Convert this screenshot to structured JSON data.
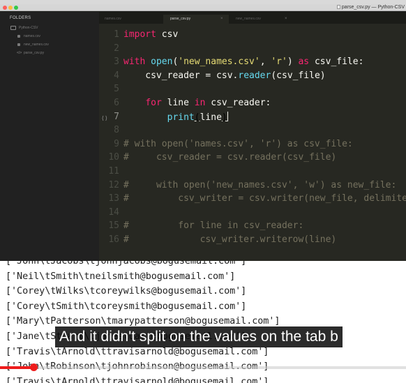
{
  "window": {
    "title": "parse_csv.py — Python-CSV"
  },
  "sidebar": {
    "heading": "FOLDERS",
    "items": [
      {
        "label": "Python-CSV",
        "type": "folder"
      },
      {
        "label": "names.csv",
        "type": "file"
      },
      {
        "label": "new_names.csv",
        "type": "file"
      },
      {
        "label": "parse_csv.py",
        "type": "py"
      }
    ]
  },
  "tabs": [
    {
      "label": "names.csv",
      "active": false
    },
    {
      "label": "parse_csv.py",
      "active": true
    },
    {
      "label": "new_names.csv",
      "active": false
    }
  ],
  "editor": {
    "line_numbers": [
      "1",
      "2",
      "3",
      "4",
      "5",
      "6",
      "7",
      "8",
      "9",
      "10",
      "11",
      "12",
      "13",
      "14",
      "15",
      "16"
    ],
    "lines": {
      "l1": [
        [
          "kw",
          "import"
        ],
        [
          "pl",
          " csv"
        ]
      ],
      "l3": [
        [
          "kw",
          "with"
        ],
        [
          "pl",
          " "
        ],
        [
          "fn",
          "open"
        ],
        [
          "pl",
          "("
        ],
        [
          "str",
          "'new_names.csv'"
        ],
        [
          "pl",
          ", "
        ],
        [
          "str",
          "'r'"
        ],
        [
          "pl",
          ") "
        ],
        [
          "kw",
          "as"
        ],
        [
          "pl",
          " csv_file:"
        ]
      ],
      "l4": [
        [
          "pl",
          "    csv_reader = csv."
        ],
        [
          "fn",
          "reader"
        ],
        [
          "pl",
          "(csv_file)"
        ]
      ],
      "l6": [
        [
          "pl",
          "    "
        ],
        [
          "kw",
          "for"
        ],
        [
          "pl",
          " line "
        ],
        [
          "kw",
          "in"
        ],
        [
          "pl",
          " csv_reader:"
        ]
      ],
      "l7": [
        [
          "pl",
          "        "
        ],
        [
          "fn",
          "print"
        ],
        [
          "ul",
          "("
        ],
        [
          "pl",
          "line"
        ],
        [
          "ul",
          ")"
        ]
      ],
      "l9": [
        [
          "cm",
          "# with open('names.csv', 'r') as csv_file:"
        ]
      ],
      "l10": [
        [
          "cm",
          "#     csv_reader = csv.reader(csv_file)"
        ]
      ],
      "l12": [
        [
          "cm",
          "#     with open('new_names.csv', 'w') as new_file:"
        ]
      ],
      "l13": [
        [
          "cm",
          "#         csv_writer = csv.writer(new_file, delimiter='\\t')"
        ]
      ],
      "l15": [
        [
          "cm",
          "#         for line in csv_reader:"
        ]
      ],
      "l16": [
        [
          "cm",
          "#             csv_writer.writerow(line)"
        ]
      ]
    }
  },
  "terminal": {
    "lines": [
      "['John\\tJacobs\\tjohnjacobs@bogusemail.com']",
      "['Neil\\tSmith\\tneilsmith@bogusemail.com']",
      "['Corey\\tWilks\\tcoreywilks@bogusemail.com']",
      "['Corey\\tSmith\\tcoreysmith@bogusemail.com']",
      "['Mary\\tPatterson\\tmarypatterson@bogusemail.com']",
      "['Jane\\tStuart\\tjanestuart@bogusemail.com']",
      "['Travis\\tArnold\\ttravisarnold@bogusemail.com']",
      "['John\\tRobinson\\tjohnrobinson@bogusemail.com']",
      "['Travis\\tArnold\\ttravisarnold@bogusemail.com']"
    ]
  },
  "caption": {
    "text": "And it didn't split on the values on the tab b"
  },
  "video": {
    "progress_percent": 8.3,
    "progress_color": "#ee1c1c"
  },
  "colors": {
    "editor_bg": "#272822",
    "keyword": "#f92672",
    "function": "#66d9ef",
    "string": "#e6db74",
    "comment": "#75715e"
  }
}
